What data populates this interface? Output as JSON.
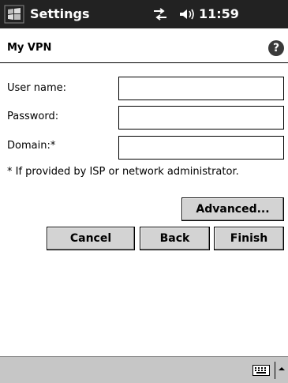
{
  "titlebar": {
    "app_title": "Settings",
    "time": "11:59",
    "icons": [
      "windows-start-icon",
      "network-icon",
      "volume-icon"
    ]
  },
  "header": {
    "title": "My VPN",
    "help_icon": "help-icon",
    "help_glyph": "?"
  },
  "form": {
    "username_label": "User name:",
    "username_value": "",
    "password_label": "Password:",
    "password_value": "",
    "domain_label": "Domain:*",
    "domain_value": "",
    "note": "* If provided by ISP or network administrator."
  },
  "buttons": {
    "advanced": "Advanced...",
    "cancel": "Cancel",
    "back": "Back",
    "finish": "Finish"
  },
  "menubar": {
    "icons": [
      "keyboard-icon",
      "sip-arrow-up-icon"
    ]
  },
  "colors": {
    "titlebar_bg": "#222222",
    "button_face": "#d3d3d3",
    "menubar_bg": "#c6c6c6"
  }
}
